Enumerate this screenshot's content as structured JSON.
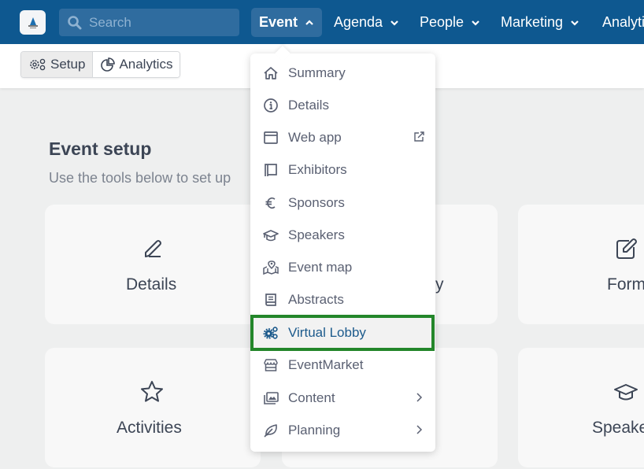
{
  "topbar": {
    "search_placeholder": "Search",
    "nav": [
      {
        "label": "Event",
        "active": true,
        "chevron": "up"
      },
      {
        "label": "Agenda",
        "chevron": "down"
      },
      {
        "label": "People",
        "chevron": "down"
      },
      {
        "label": "Marketing",
        "chevron": "down"
      },
      {
        "label": "Analytics"
      }
    ]
  },
  "subbar": {
    "tabs": [
      {
        "label": "Setup",
        "icon": "gears-icon",
        "active": true
      },
      {
        "label": "Analytics",
        "icon": "pie-chart-icon"
      }
    ]
  },
  "page": {
    "title": "Event setup",
    "subtitle": "Use the tools below to set up",
    "cards": [
      {
        "label": "Details",
        "icon": "pencil-icon"
      },
      {
        "label": "y",
        "icon": ""
      },
      {
        "label": "Form",
        "icon": "edit-square-icon"
      },
      {
        "label": "Activities",
        "icon": "star-icon"
      },
      {
        "label": "",
        "icon": ""
      },
      {
        "label": "Speake",
        "icon": "graduation-cap-icon"
      }
    ]
  },
  "menu": {
    "items": [
      {
        "label": "Summary",
        "icon": "home-icon"
      },
      {
        "label": "Details",
        "icon": "info-icon"
      },
      {
        "label": "Web app",
        "icon": "browser-window-icon",
        "trailing": "external-link-icon"
      },
      {
        "label": "Exhibitors",
        "icon": "booth-icon"
      },
      {
        "label": "Sponsors",
        "icon": "euro-icon"
      },
      {
        "label": "Speakers",
        "icon": "graduation-cap-icon"
      },
      {
        "label": "Event map",
        "icon": "map-pin-icon"
      },
      {
        "label": "Abstracts",
        "icon": "book-icon"
      },
      {
        "label": "Virtual Lobby",
        "icon": "gears-icon",
        "highlighted": true
      },
      {
        "label": "EventMarket",
        "icon": "store-icon"
      },
      {
        "label": "Content",
        "icon": "images-icon",
        "trailing": "chevron-right-icon"
      },
      {
        "label": "Planning",
        "icon": "leaf-icon",
        "trailing": "chevron-right-icon"
      }
    ]
  },
  "colors": {
    "navbar": "#0e5890",
    "highlight_border": "#23862a",
    "active_menu_text": "#1c5a8c"
  }
}
